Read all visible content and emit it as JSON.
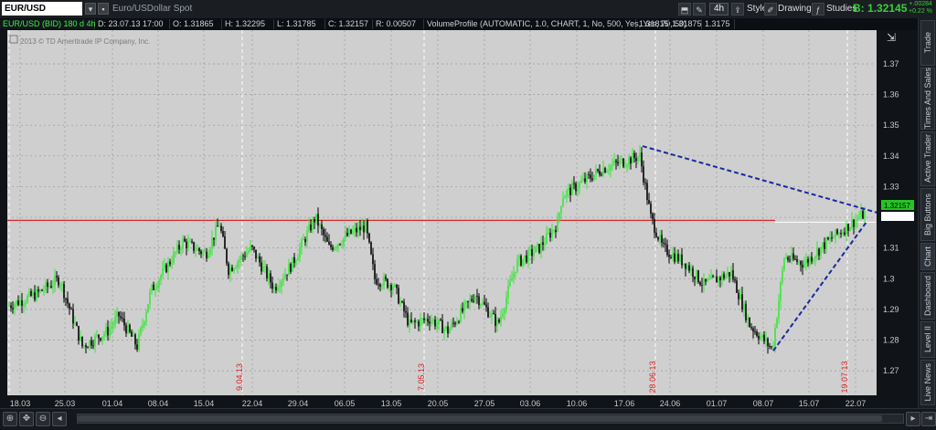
{
  "toolbar": {
    "symbol": "EUR/USD",
    "description": "Euro/USDollar Spot",
    "timeframe": "4h",
    "style": "Style",
    "drawings": "Drawings",
    "studies": "Studies",
    "bid_label": "B:",
    "bid_value": "1.32145",
    "change_abs": "+.00284",
    "change_pct": "+0.22 %"
  },
  "info": {
    "symbol_line": "EUR/USD (BID) 180 d 4h",
    "date": "D: 23.07.13 17:00",
    "open": "O: 1.31865",
    "high": "H: 1.32295",
    "low": "L: 1.31785",
    "close": "C: 1.32157",
    "range": "R: 0.00507",
    "volume_profile": "VolumeProfile (AUTOMATIC, 1.0, CHART, 1, No, 500, Yes, Yes, 70, 50)",
    "vp1": "1.31815",
    "vp2": "1.31875",
    "vp3": "1.3175"
  },
  "copyright": "2013 © TD Ameritrade IP Company, Inc.",
  "colors": {
    "up": "#39e63a",
    "down": "#000000",
    "background": "#cfcfcf",
    "trend": "#1a2a9a",
    "hline": "#d92a2a"
  },
  "chart_data": {
    "type": "candlestick",
    "symbol": "EUR/USD",
    "price_range": [
      1.262,
      1.381
    ],
    "y_ticks": [
      "1.27",
      "1.28",
      "1.29",
      "1.3",
      "1.31",
      "1.32",
      "1.33",
      "1.34",
      "1.35",
      "1.36",
      "1.37"
    ],
    "x_ticks": [
      "18.03",
      "25.03",
      "01.04",
      "08.04",
      "15.04",
      "22.04",
      "29.04",
      "06.05",
      "13.05",
      "20.05",
      "27.05",
      "03.06",
      "10.06",
      "17.06",
      "24.06",
      "01.07",
      "08.07",
      "15.07",
      "22.07"
    ],
    "price_path": [
      [
        0,
        1.29
      ],
      [
        40,
        1.295
      ],
      [
        65,
        1.3
      ],
      [
        90,
        1.278
      ],
      [
        118,
        1.283
      ],
      [
        130,
        1.288
      ],
      [
        150,
        1.278
      ],
      [
        165,
        1.296
      ],
      [
        200,
        1.312
      ],
      [
        225,
        1.308
      ],
      [
        240,
        1.318
      ],
      [
        250,
        1.303
      ],
      [
        275,
        1.31
      ],
      [
        300,
        1.297
      ],
      [
        320,
        1.305
      ],
      [
        345,
        1.32
      ],
      [
        360,
        1.31
      ],
      [
        385,
        1.315
      ],
      [
        400,
        1.317
      ],
      [
        410,
        1.3
      ],
      [
        430,
        1.298
      ],
      [
        448,
        1.285
      ],
      [
        470,
        1.287
      ],
      [
        490,
        1.283
      ],
      [
        520,
        1.295
      ],
      [
        545,
        1.285
      ],
      [
        565,
        1.305
      ],
      [
        590,
        1.31
      ],
      [
        610,
        1.318
      ],
      [
        615,
        1.327
      ],
      [
        640,
        1.332
      ],
      [
        660,
        1.336
      ],
      [
        700,
        1.34
      ],
      [
        712,
        1.32
      ],
      [
        725,
        1.31
      ],
      [
        750,
        1.305
      ],
      [
        770,
        1.298
      ],
      [
        800,
        1.302
      ],
      [
        820,
        1.285
      ],
      [
        845,
        1.277
      ],
      [
        858,
        1.307
      ],
      [
        880,
        1.305
      ],
      [
        905,
        1.312
      ],
      [
        940,
        1.32
      ],
      [
        948,
        1.3216
      ]
    ],
    "current_price": "1.32157",
    "horizontal_line": 1.319,
    "trendlines": [
      {
        "from": [
          "17.06",
          1.3432
        ],
        "to": [
          "22.07",
          1.3215
        ],
        "style": "dashed"
      },
      {
        "from": [
          "08.07",
          1.2765
        ],
        "to": [
          "22.07",
          1.3185
        ],
        "style": "dashed"
      }
    ],
    "date_markers": [
      "9.04.13",
      "7.05.13",
      "28.06.13",
      "19.07.13"
    ]
  },
  "side_tabs": [
    "Trade",
    "Times And Sales",
    "Active Trader",
    "Big Buttons",
    "Chart",
    "Dashboard",
    "Level II",
    "Live News"
  ]
}
